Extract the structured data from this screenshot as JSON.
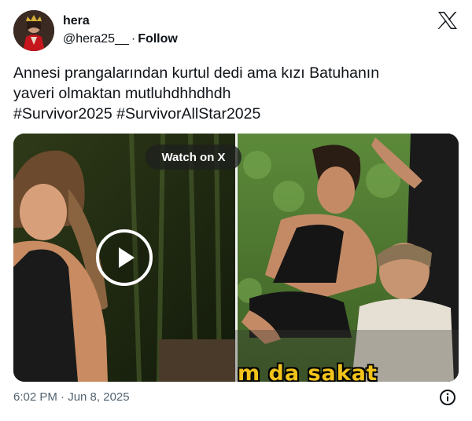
{
  "author": {
    "name": "hera",
    "handle": "@hera25__",
    "separator": "·",
    "follow_label": "Follow"
  },
  "tweet": {
    "lines": [
      "Annesi prangalarından kurtul dedi ama kızı Batuhanın",
      "yaveri olmaktan mutluhdhhdhdh",
      "#Survivor2025 #SurvivorAllStar2025"
    ]
  },
  "media": {
    "watch_label": "Watch on X",
    "caption_overlay": "m da sakat"
  },
  "footer": {
    "timestamp": "6:02 PM · Jun 8, 2025"
  },
  "icons": {
    "logo": "x-logo-icon",
    "play": "play-icon",
    "info": "info-icon"
  },
  "colors": {
    "text": "#0f1419",
    "secondary": "#536471",
    "subtitle": "#f2c41a"
  }
}
